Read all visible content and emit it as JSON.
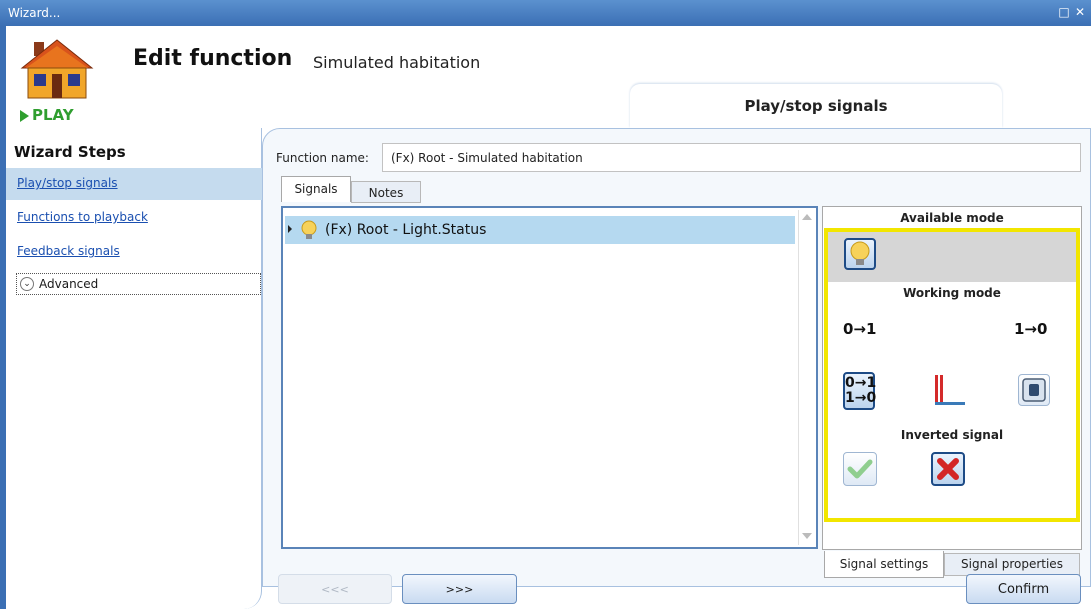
{
  "window": {
    "title": "Wizard...",
    "restore_icon": "restore-icon",
    "close_icon": "close-icon"
  },
  "header": {
    "logo_icon": "house-play-icon",
    "logo_text": "PLAY",
    "title": "Edit function",
    "subtitle": "Simulated habitation",
    "current_step": "Play/stop signals"
  },
  "sidebar": {
    "title": "Wizard Steps",
    "items": [
      {
        "label": "Play/stop signals",
        "active": true
      },
      {
        "label": "Functions to playback",
        "active": false
      },
      {
        "label": "Feedback signals",
        "active": false
      }
    ],
    "advanced_label": "Advanced"
  },
  "form": {
    "function_name_label": "Function name:",
    "function_name_value": "(Fx) Root - Simulated habitation"
  },
  "tabs": {
    "signals": "Signals",
    "notes": "Notes"
  },
  "signals_list": {
    "rows": [
      {
        "icon": "lightbulb-icon",
        "label": "(Fx) Root - Light.Status"
      }
    ]
  },
  "settings": {
    "available_mode": "Available mode",
    "working_mode": "Working mode",
    "inverted_signal": "Inverted signal",
    "mode_rising": "0→1",
    "mode_falling": "1→0",
    "mode_both_top": "0→1",
    "mode_both_bottom": "1→0",
    "highlight_color": "#f2e600"
  },
  "bottom_tabs": {
    "signal_settings": "Signal settings",
    "signal_properties": "Signal properties"
  },
  "nav": {
    "prev": "<<<",
    "next": ">>>",
    "confirm": "Confirm"
  }
}
